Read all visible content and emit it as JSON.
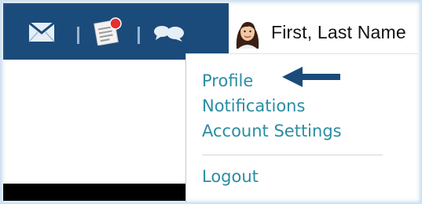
{
  "header": {
    "icons": [
      {
        "name": "messages-icon"
      },
      {
        "name": "notifications-icon"
      },
      {
        "name": "chat-icon"
      }
    ],
    "user_name": "First,  Last Name"
  },
  "dropdown": {
    "items": [
      {
        "label": "Profile"
      },
      {
        "label": "Notifications"
      },
      {
        "label": "Account Settings"
      }
    ],
    "logout_label": "Logout"
  },
  "colors": {
    "topbar": "#1b4b7a",
    "link": "#2a8da4",
    "arrow": "#1b4b7a",
    "badge": "#e53030"
  }
}
